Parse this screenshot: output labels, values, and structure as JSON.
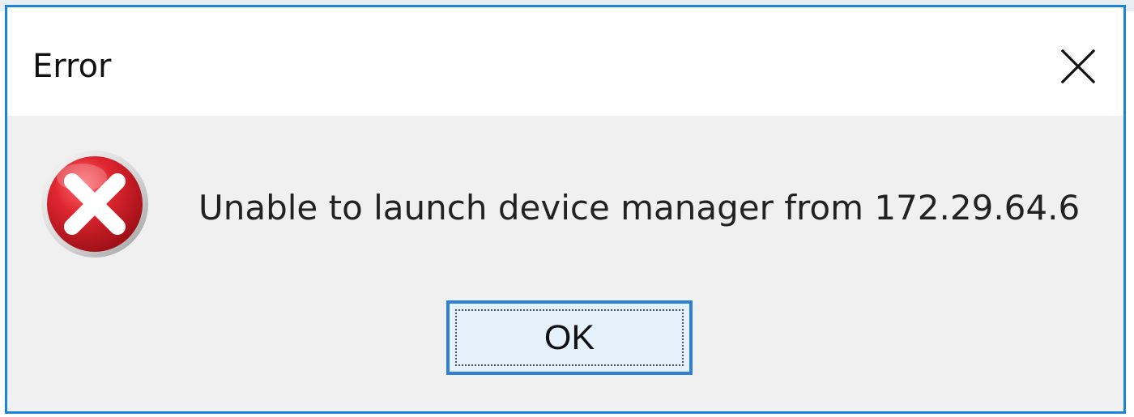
{
  "window": {
    "title": "Error",
    "accent_color": "#1a84d6",
    "close_icon": "close-icon"
  },
  "dialog": {
    "icon": "error-icon",
    "message": "Unable to launch device manager from 172.29.64.6",
    "buttons": [
      {
        "label": "OK",
        "focused": true
      }
    ]
  },
  "colors": {
    "title_bar": "#ffffff",
    "content_background": "#f0f0f0",
    "button_background": "#e5f1fb",
    "button_border": "#2f7fd5",
    "error_red": "#c9242f"
  }
}
